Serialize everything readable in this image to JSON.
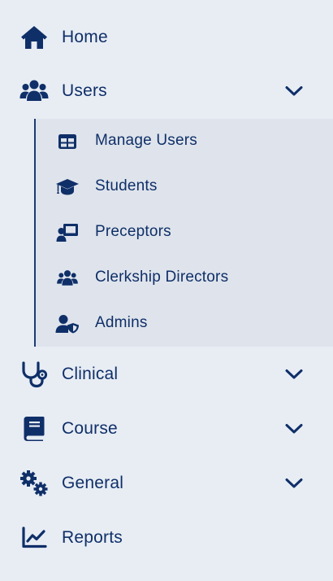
{
  "nav": {
    "items": [
      {
        "label": "Home",
        "icon": "home-icon"
      },
      {
        "label": "Users",
        "icon": "users-icon",
        "expanded": true
      },
      {
        "label": "Clinical",
        "icon": "stethoscope-icon",
        "expanded": false
      },
      {
        "label": "Course",
        "icon": "book-icon",
        "expanded": false
      },
      {
        "label": "General",
        "icon": "gears-icon",
        "expanded": false
      },
      {
        "label": "Reports",
        "icon": "chart-line-icon"
      }
    ],
    "users_sub": [
      {
        "label": "Manage Users",
        "icon": "table-icon"
      },
      {
        "label": "Students",
        "icon": "graduation-cap-icon"
      },
      {
        "label": "Preceptors",
        "icon": "chalkboard-user-icon"
      },
      {
        "label": "Clerkship Directors",
        "icon": "users-icon"
      },
      {
        "label": "Admins",
        "icon": "user-shield-icon"
      }
    ]
  },
  "colors": {
    "background": "#e8edf4",
    "submenu_background": "#dfe4ec",
    "text": "#0f2f68",
    "accent": "#1c3b74"
  }
}
